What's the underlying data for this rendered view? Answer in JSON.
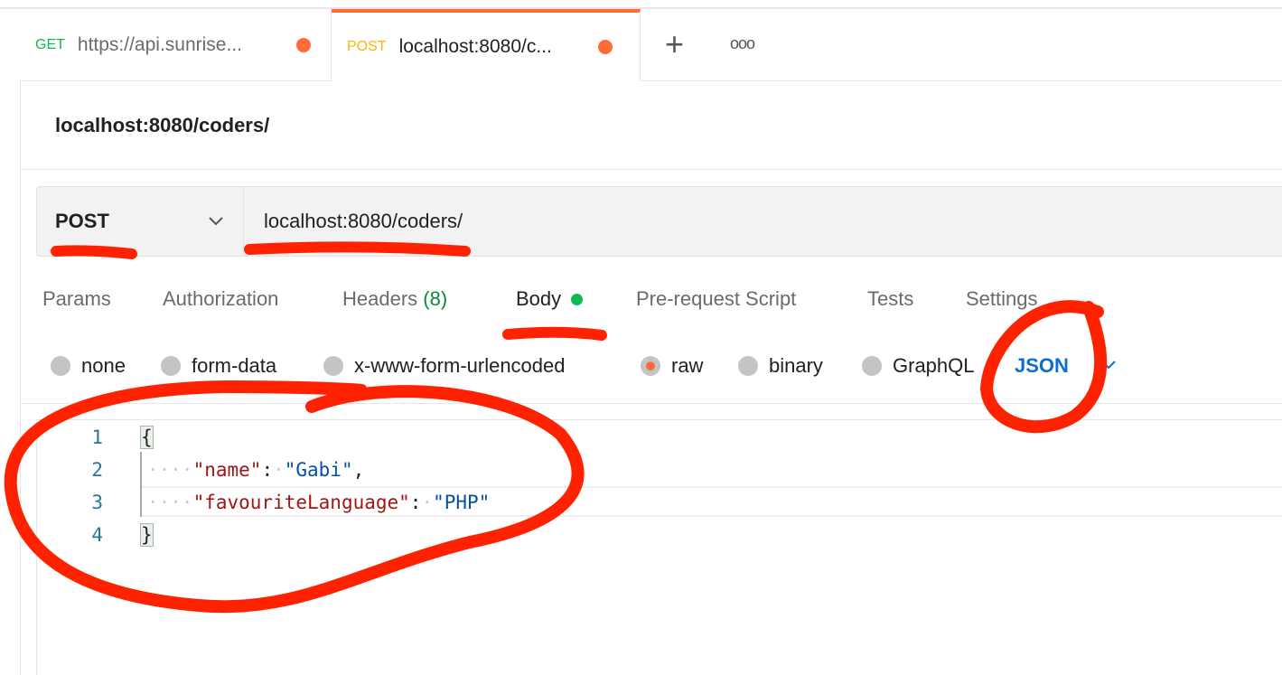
{
  "tabs": [
    {
      "method": "GET",
      "url": "https://api.sunrise...",
      "method_color": "#0cbb52"
    },
    {
      "method": "POST",
      "url": "localhost:8080/c...",
      "method_color": "#ffb400",
      "active": true
    }
  ],
  "tab_actions": {
    "new_tab": "+",
    "more": "ooo"
  },
  "request_title": "localhost:8080/coders/",
  "request": {
    "method": "POST",
    "url": "localhost:8080/coders/"
  },
  "request_tabs": [
    {
      "label": "Params"
    },
    {
      "label": "Authorization"
    },
    {
      "label": "Headers",
      "count": "(8)"
    },
    {
      "label": "Body",
      "active": true
    },
    {
      "label": "Pre-request Script"
    },
    {
      "label": "Tests"
    },
    {
      "label": "Settings"
    }
  ],
  "body_types": [
    {
      "label": "none"
    },
    {
      "label": "form-data"
    },
    {
      "label": "x-www-form-urlencoded"
    },
    {
      "label": "raw",
      "selected": true
    },
    {
      "label": "binary"
    },
    {
      "label": "GraphQL"
    }
  ],
  "raw_format": "JSON",
  "editor": {
    "line_numbers": [
      "1",
      "2",
      "3",
      "4"
    ],
    "open_brace": "{",
    "close_brace": "}",
    "key1": "\"name\"",
    "val1": "\"Gabi\"",
    "key2": "\"favouriteLanguage\"",
    "val2": "\"PHP\"",
    "colon": ":",
    "comma": ","
  },
  "colors": {
    "accent": "#ff6c37",
    "annotation": "#ff2200",
    "link": "#0b6fd1"
  }
}
